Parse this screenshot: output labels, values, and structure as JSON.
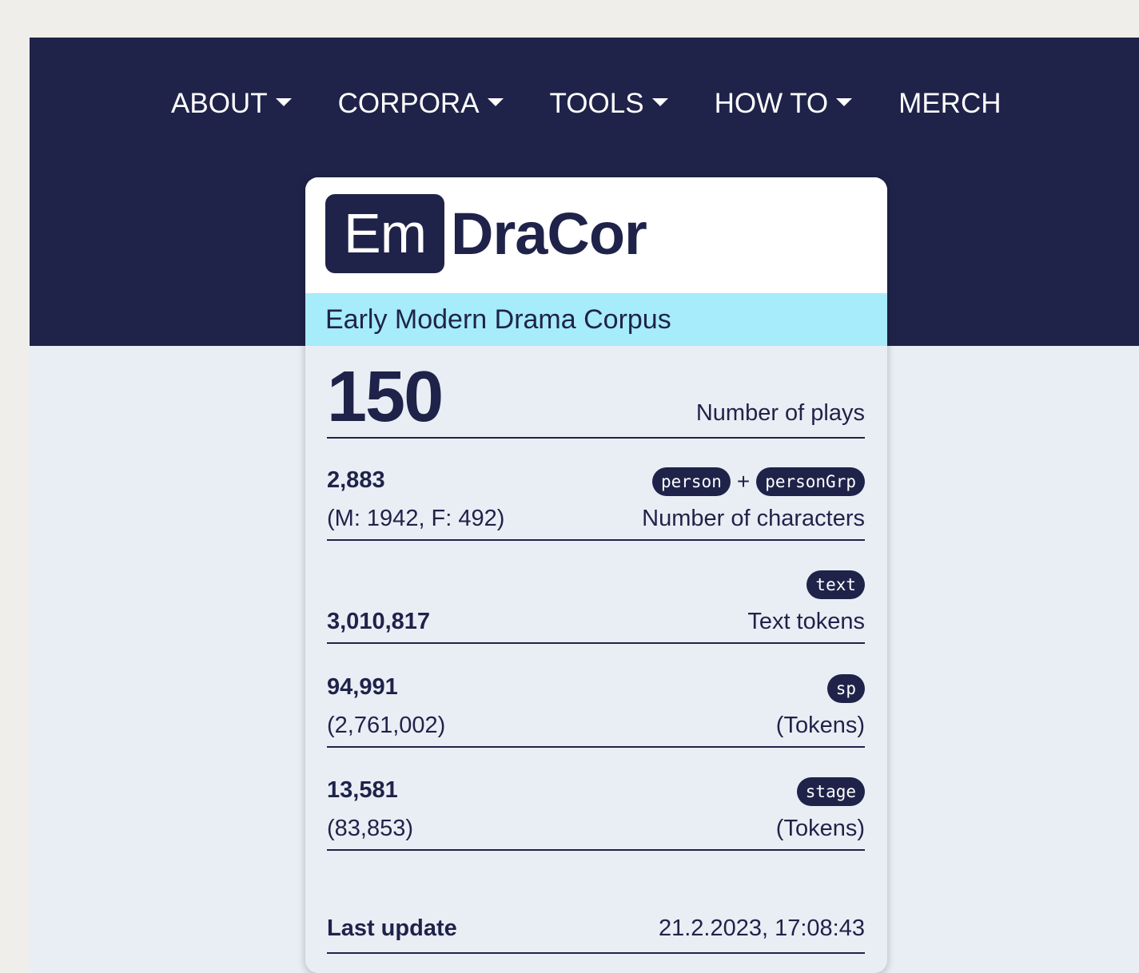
{
  "nav": {
    "items": [
      {
        "label": "ABOUT",
        "dropdown": true
      },
      {
        "label": "CORPORA",
        "dropdown": true
      },
      {
        "label": "TOOLS",
        "dropdown": true
      },
      {
        "label": "HOW TO",
        "dropdown": true
      },
      {
        "label": "MERCH",
        "dropdown": false
      }
    ]
  },
  "card": {
    "logo_box": "Em",
    "logo_text": "DraCor",
    "subtitle": "Early Modern Drama Corpus",
    "plays": {
      "value": "150",
      "label": "Number of plays"
    },
    "characters": {
      "value": "2,883",
      "detail": "(M: 1942, F: 492)",
      "tag1": "person",
      "plus": "+",
      "tag2": "personGrp",
      "label": "Number of characters"
    },
    "text": {
      "value": "3,010,817",
      "tag": "text",
      "label": "Text tokens"
    },
    "sp": {
      "value": "94,991",
      "detail": "(2,761,002)",
      "tag": "sp",
      "label": "(Tokens)"
    },
    "stage": {
      "value": "13,581",
      "detail": "(83,853)",
      "tag": "stage",
      "label": "(Tokens)"
    },
    "updated": {
      "label": "Last update",
      "value": "21.2.2023, 17:08:43"
    }
  },
  "colors": {
    "navy": "#1f2349",
    "cyan_band": "#a6ecfb",
    "page_bg": "#e9eef5",
    "outer_bg": "#efeeeb"
  }
}
